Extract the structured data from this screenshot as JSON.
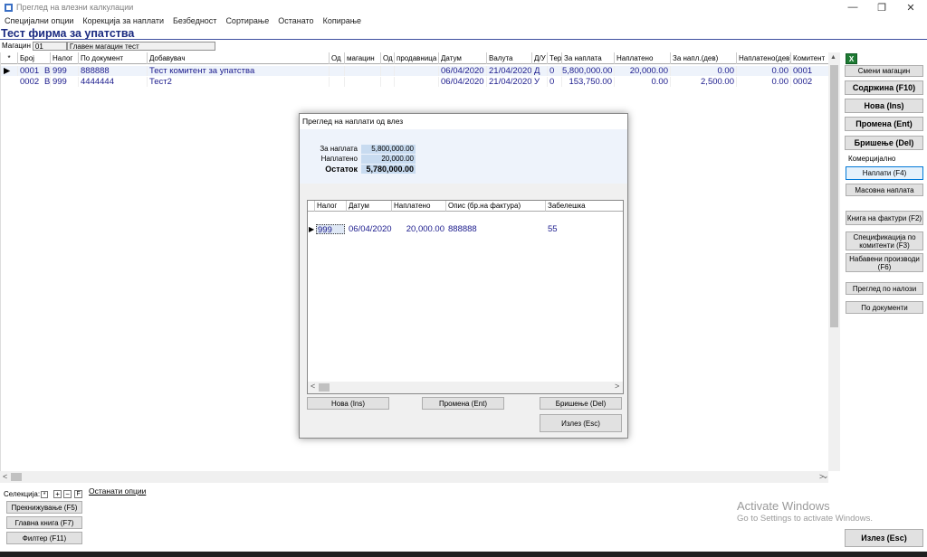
{
  "window": {
    "title": "Преглед на влезни калкулации"
  },
  "menu": [
    "Специјални опции",
    "Корекција за наплати",
    "Безбедност",
    "Сортирање",
    "Останато",
    "Копирање"
  ],
  "firm": "Тест фирма за упатства",
  "warehouse": {
    "label": "Магацин",
    "code": "01",
    "name": "Главен магацин тест"
  },
  "grid": {
    "columns": [
      "*",
      "Број",
      "Налог",
      "По документ",
      "Добавувач",
      "Од",
      "магацин",
      "Од",
      "продавница",
      "Датум",
      "Валута",
      "Д/У",
      "Тер",
      "За наплата",
      "Наплатено",
      "За напл.(дев)",
      "Наплатено(дев)",
      "Комитент"
    ],
    "rows": [
      [
        "",
        "0001",
        "В 999",
        "888888",
        "Тест комитент за упатства",
        "",
        "",
        "",
        "",
        "06/04/2020",
        "21/04/2020",
        "Д",
        "0",
        "5,800,000.00",
        "20,000.00",
        "0.00",
        "0.00",
        "0001"
      ],
      [
        "",
        "0002",
        "В 999",
        "4444444",
        "Тест2",
        "",
        "",
        "",
        "",
        "06/04/2020",
        "21/04/2020",
        "У",
        "0",
        "153,750.00",
        "0.00",
        "2,500.00",
        "0.00",
        "0002"
      ]
    ]
  },
  "side": {
    "change_wh": "Смени магацин",
    "content": "Содржина (F10)",
    "new": "Нова (Ins)",
    "edit": "Промена (Ent)",
    "delete": "Бришење (Del)",
    "commercial": "Комерцијално",
    "payments": "Наплати (F4)",
    "mass_payment": "Масовна наплата",
    "invoice_book": "Книга на фактури (F2)",
    "spec_line1": "Спецификација по",
    "spec_line2": "комитенти (F3)",
    "purchased_line1": "Набавени производи",
    "purchased_line2": "(F6)",
    "by_orders": "Преглед по налози",
    "by_docs": "По документи",
    "exit": "Излез (Esc)"
  },
  "bottom": {
    "selection": "Селекција:",
    "sel_star": "*",
    "sel_plus": "+",
    "sel_minus": "−",
    "sel_f": "F",
    "other_options": "Останати опции",
    "toggle": "Прекнижување (F5)",
    "ledger": "Главна книга (F7)",
    "filter": "Филтер (F11)"
  },
  "dialog": {
    "title": "Преглед на наплати од влез",
    "labels": [
      "За наплата",
      "Наплатено",
      "Остаток"
    ],
    "values": [
      "5,800,000.00",
      "20,000.00",
      "5,780,000.00"
    ],
    "columns": [
      "Налог",
      "Датум",
      "Наплатено",
      "Опис (бр.на фактура)",
      "Забелешка"
    ],
    "row": [
      "999",
      "06/04/2020",
      "20,000.00",
      "888888",
      "55"
    ],
    "new": "Нова (Ins)",
    "edit": "Промена (Ent)",
    "delete": "Бришење (Del)",
    "exit": "Излез (Esc)"
  },
  "activation": {
    "line1": "Activate Windows",
    "line2": "Go to Settings to activate Windows."
  }
}
